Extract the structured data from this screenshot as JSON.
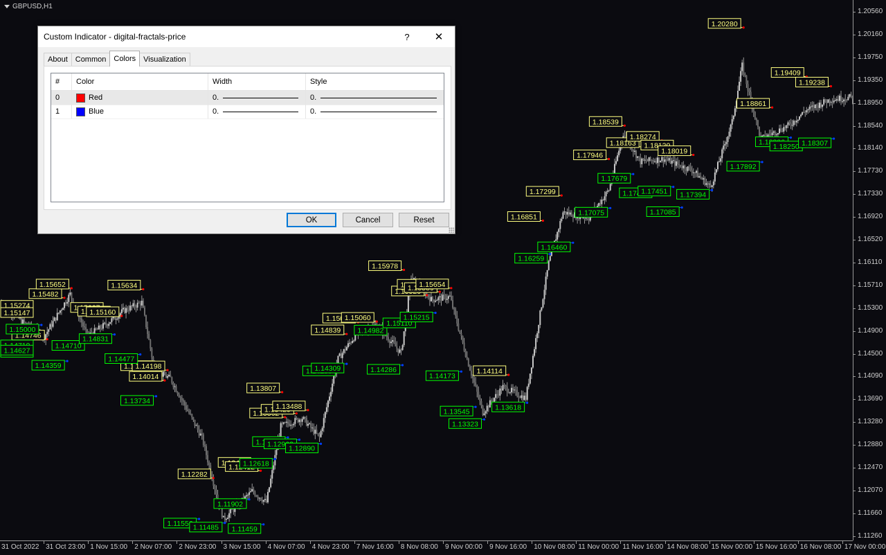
{
  "chart": {
    "symbol": "GBPUSD,H1",
    "price_scale": [
      "1.20560",
      "1.20160",
      "1.19750",
      "1.19350",
      "1.18950",
      "1.18540",
      "1.18140",
      "1.17730",
      "1.17330",
      "1.16920",
      "1.16520",
      "1.16110",
      "1.15710",
      "1.15300",
      "1.14900",
      "1.14500",
      "1.14090",
      "1.13690",
      "1.13280",
      "1.12880",
      "1.12470",
      "1.12070",
      "1.11660",
      "1.11260"
    ],
    "time_scale": [
      "31 Oct 2022",
      "31 Oct 23:00",
      "1 Nov 15:00",
      "2 Nov 07:00",
      "2 Nov 23:00",
      "3 Nov 15:00",
      "4 Nov 07:00",
      "4 Nov 23:00",
      "7 Nov 16:00",
      "8 Nov 08:00",
      "9 Nov 00:00",
      "9 Nov 16:00",
      "10 Nov 08:00",
      "11 Nov 00:00",
      "11 Nov 16:00",
      "14 Nov 08:00",
      "15 Nov 00:00",
      "15 Nov 16:00",
      "16 Nov 08:00",
      "17 Nov 00:00"
    ],
    "colors": {
      "background": "#0b0b10",
      "candle": "#9a9a9a",
      "high_label": "#ffff80",
      "low_label": "#00ff00",
      "high_dot": "#ff0000",
      "low_line": "#0040ff"
    },
    "fractal_highs": [
      {
        "t": 0,
        "price": "1.15274"
      },
      {
        "t": 15,
        "price": "1.15147"
      },
      {
        "t": 31,
        "price": "1.14746"
      },
      {
        "t": 43,
        "price": "1.15482"
      },
      {
        "t": 48,
        "price": "1.15652"
      },
      {
        "t": 72,
        "price": "1.15237"
      },
      {
        "t": 77,
        "price": "1.15171"
      },
      {
        "t": 83,
        "price": "1.15160"
      },
      {
        "t": 98,
        "price": "1.15634"
      },
      {
        "t": 107,
        "price": "1.14203"
      },
      {
        "t": 113,
        "price": "1.14014"
      },
      {
        "t": 115,
        "price": "1.14198"
      },
      {
        "t": 147,
        "price": "1.12282"
      },
      {
        "t": 175,
        "price": "1.12486"
      },
      {
        "t": 180,
        "price": "1.12412"
      },
      {
        "t": 195,
        "price": "1.13807"
      },
      {
        "t": 197,
        "price": "1.13362"
      },
      {
        "t": 205,
        "price": "1.13429"
      },
      {
        "t": 213,
        "price": "1.13488"
      },
      {
        "t": 240,
        "price": "1.14839"
      },
      {
        "t": 248,
        "price": "1.15048"
      },
      {
        "t": 261,
        "price": "1.15060"
      },
      {
        "t": 280,
        "price": "1.15978"
      },
      {
        "t": 296,
        "price": "1.15529"
      },
      {
        "t": 300,
        "price": "1.15648"
      },
      {
        "t": 305,
        "price": "1.15589"
      },
      {
        "t": 313,
        "price": "1.15654"
      },
      {
        "t": 353,
        "price": "1.14114"
      },
      {
        "t": 377,
        "price": "1.16851"
      },
      {
        "t": 390,
        "price": "1.17299"
      },
      {
        "t": 423,
        "price": "1.17946"
      },
      {
        "t": 434,
        "price": "1.18539"
      },
      {
        "t": 446,
        "price": "1.18163"
      },
      {
        "t": 460,
        "price": "1.18274"
      },
      {
        "t": 470,
        "price": "1.18120"
      },
      {
        "t": 482,
        "price": "1.18019"
      },
      {
        "t": 517,
        "price": "1.20280"
      },
      {
        "t": 537,
        "price": "1.18861"
      },
      {
        "t": 561,
        "price": "1.19409"
      },
      {
        "t": 578,
        "price": "1.19238"
      }
    ],
    "fractal_lows": [
      {
        "t": 0,
        "price": "1.14719"
      },
      {
        "t": 0,
        "price": "1.14589"
      },
      {
        "t": 18,
        "price": "1.14627"
      },
      {
        "t": 27,
        "price": "1.15000"
      },
      {
        "t": 45,
        "price": "1.14359"
      },
      {
        "t": 59,
        "price": "1.14710"
      },
      {
        "t": 78,
        "price": "1.14831"
      },
      {
        "t": 96,
        "price": "1.14477"
      },
      {
        "t": 107,
        "price": "1.13734"
      },
      {
        "t": 137,
        "price": "1.11556"
      },
      {
        "t": 155,
        "price": "1.11485"
      },
      {
        "t": 172,
        "price": "1.11902"
      },
      {
        "t": 182,
        "price": "1.11459"
      },
      {
        "t": 190,
        "price": "1.12618"
      },
      {
        "t": 199,
        "price": "1.13003"
      },
      {
        "t": 207,
        "price": "1.12962"
      },
      {
        "t": 222,
        "price": "1.12890"
      },
      {
        "t": 234,
        "price": "1.14259"
      },
      {
        "t": 240,
        "price": "1.14309"
      },
      {
        "t": 270,
        "price": "1.14982"
      },
      {
        "t": 279,
        "price": "1.14286"
      },
      {
        "t": 290,
        "price": "1.15110"
      },
      {
        "t": 302,
        "price": "1.15215"
      },
      {
        "t": 320,
        "price": "1.14173"
      },
      {
        "t": 330,
        "price": "1.13545"
      },
      {
        "t": 336,
        "price": "1.13323"
      },
      {
        "t": 366,
        "price": "1.13618"
      },
      {
        "t": 382,
        "price": "1.16259"
      },
      {
        "t": 398,
        "price": "1.16460"
      },
      {
        "t": 424,
        "price": "1.17075"
      },
      {
        "t": 440,
        "price": "1.17679"
      },
      {
        "t": 455,
        "price": "1.17420"
      },
      {
        "t": 468,
        "price": "1.17451"
      },
      {
        "t": 495,
        "price": "1.17394"
      },
      {
        "t": 474,
        "price": "1.17085"
      },
      {
        "t": 530,
        "price": "1.17892"
      },
      {
        "t": 550,
        "price": "1.18326"
      },
      {
        "t": 560,
        "price": "1.18250"
      },
      {
        "t": 580,
        "price": "1.18307"
      }
    ]
  },
  "dialog": {
    "title": "Custom Indicator - digital-fractals-price",
    "help": "?",
    "close": "✕",
    "tabs": [
      "About",
      "Common",
      "Colors",
      "Visualization"
    ],
    "active_tab": "Colors",
    "columns": [
      "#",
      "Color",
      "Width",
      "Style"
    ],
    "rows": [
      {
        "index": "0",
        "color_name": "Red",
        "color_hex": "#ff0000",
        "width": "0.",
        "style": "0."
      },
      {
        "index": "1",
        "color_name": "Blue",
        "color_hex": "#0000ff",
        "width": "0.",
        "style": "0."
      }
    ],
    "buttons": {
      "ok": "OK",
      "cancel": "Cancel",
      "reset": "Reset"
    }
  }
}
